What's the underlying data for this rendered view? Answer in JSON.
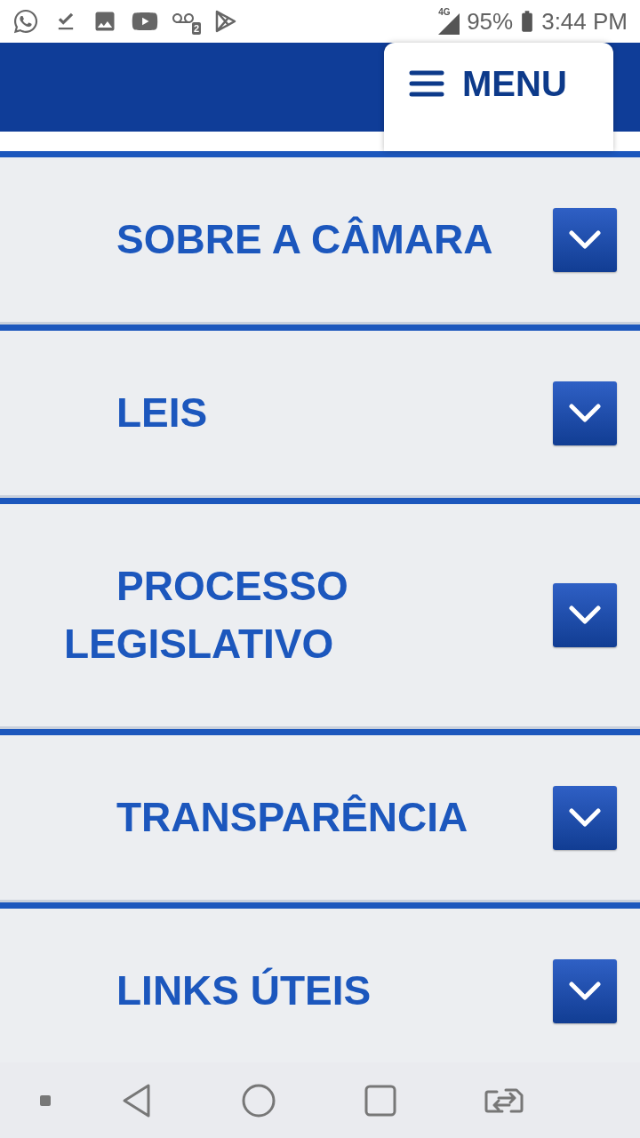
{
  "status_bar": {
    "notification_badge": "2",
    "network": "4G",
    "battery": "95%",
    "time": "3:44 PM"
  },
  "header": {
    "menu_label": "MENU"
  },
  "menu_items": [
    {
      "label": "SOBRE A CÂMARA",
      "expanded": false
    },
    {
      "label": "LEIS",
      "expanded": false
    },
    {
      "label": "PROCESSO LEGISLATIVO",
      "expanded": false
    },
    {
      "label": "TRANSPARÊNCIA",
      "expanded": false
    },
    {
      "label": "LINKS ÚTEIS",
      "expanded": false
    }
  ]
}
